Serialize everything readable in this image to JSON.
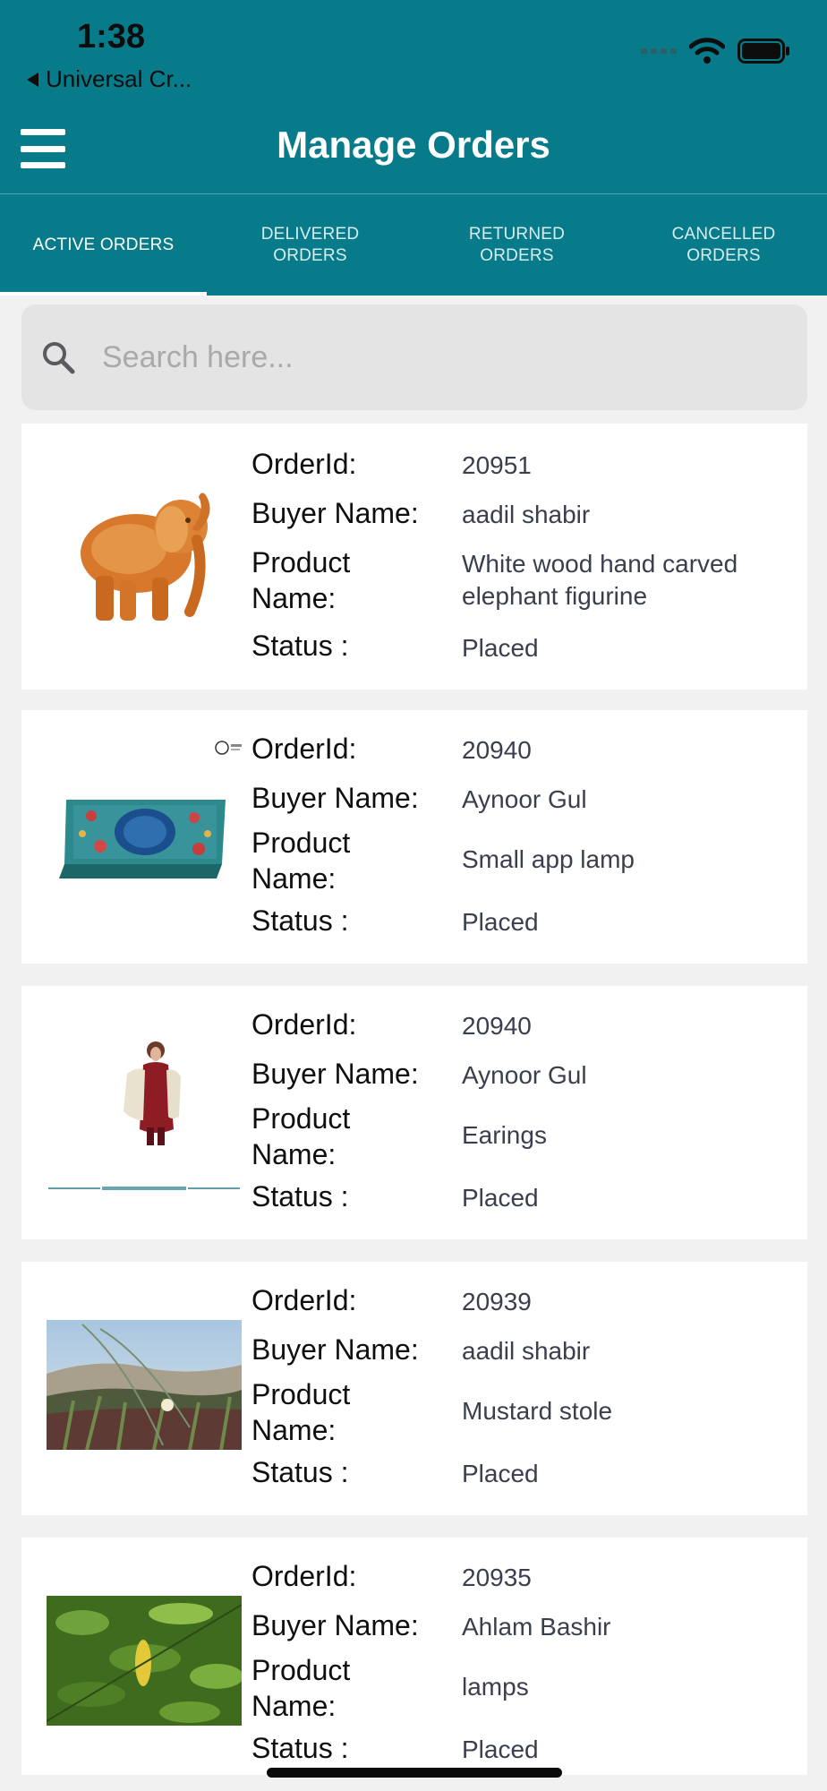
{
  "status_bar": {
    "time": "1:38",
    "back_app": "Universal Cr..."
  },
  "header": {
    "title": "Manage Orders"
  },
  "tabs": [
    {
      "label": "ACTIVE ORDERS",
      "active": true
    },
    {
      "label": "DELIVERED\nORDERS",
      "active": false
    },
    {
      "label": "RETURNED\nORDERS",
      "active": false
    },
    {
      "label": "CANCELLED\nORDERS",
      "active": false
    }
  ],
  "search": {
    "placeholder": "Search here..."
  },
  "labels": {
    "order_id": "OrderId:",
    "buyer_name": "Buyer Name:",
    "product_name": "Product\nName:",
    "status": "Status :"
  },
  "orders": [
    {
      "order_id": "20951",
      "buyer_name": "aadil  shabir",
      "product_name": "White wood hand carved elephant figurine",
      "status": "Placed"
    },
    {
      "order_id": "20940",
      "buyer_name": "Aynoor  Gul",
      "product_name": "Small app lamp",
      "status": "Placed"
    },
    {
      "order_id": "20940",
      "buyer_name": "Aynoor  Gul",
      "product_name": "Earings",
      "status": "Placed"
    },
    {
      "order_id": "20939",
      "buyer_name": "aadil  shabir",
      "product_name": "Mustard stole",
      "status": "Placed"
    },
    {
      "order_id": "20935",
      "buyer_name": "Ahlam  Bashir",
      "product_name": "lamps",
      "status": "Placed"
    }
  ],
  "colors": {
    "primary": "#087b8b",
    "background": "#f1f1f1",
    "card": "#ffffff"
  }
}
